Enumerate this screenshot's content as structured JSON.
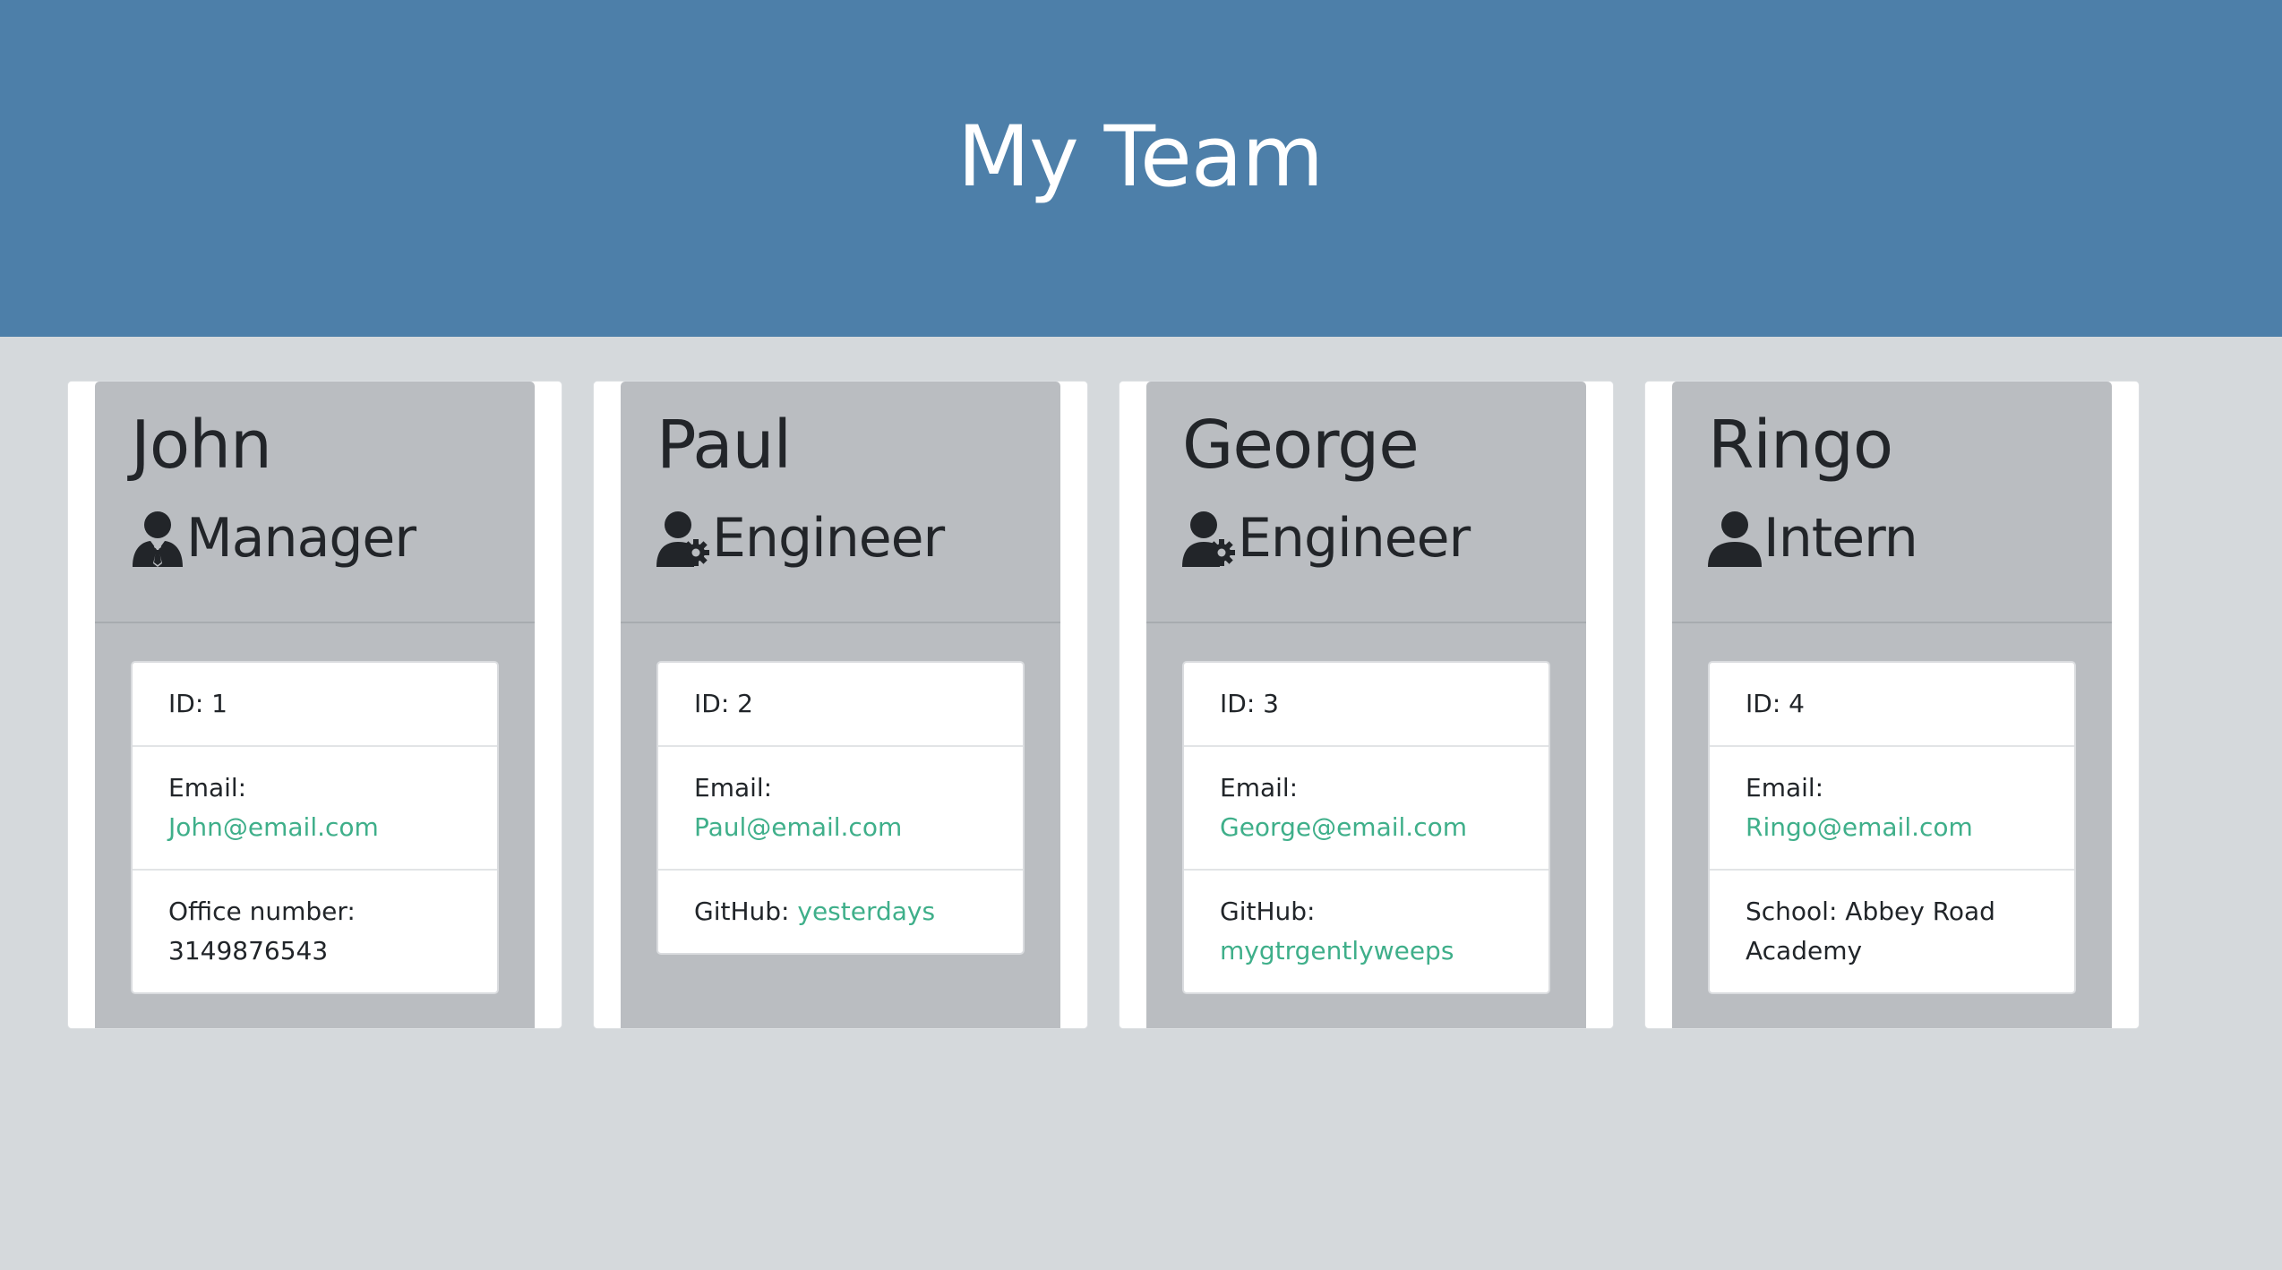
{
  "header": {
    "title": "My Team"
  },
  "colors": {
    "header_bg": "#4d7fa9",
    "link": "#3faf8a",
    "card_bg": "#babdc1"
  },
  "cards": [
    {
      "name": "John",
      "role": "Manager",
      "role_icon": "user-tie-icon",
      "id_label": "ID: 1",
      "email_label": "Email:",
      "email": "John@email.com",
      "extra_label": "Office number:",
      "extra_value": "3149876543"
    },
    {
      "name": "Paul",
      "role": "Engineer",
      "role_icon": "user-cog-icon",
      "id_label": "ID: 2",
      "email_label": "Email:",
      "email": "Paul@email.com",
      "extra_label": "GitHub:",
      "extra_value": "yesterdays"
    },
    {
      "name": "George",
      "role": "Engineer",
      "role_icon": "user-cog-icon",
      "id_label": "ID: 3",
      "email_label": "Email:",
      "email": "George@email.com",
      "extra_label": "GitHub:",
      "extra_value": "mygtrgentlyweeps"
    },
    {
      "name": "Ringo",
      "role": "Intern",
      "role_icon": "user-icon",
      "id_label": "ID: 4",
      "email_label": "Email:",
      "email": "Ringo@email.com",
      "extra_label": "School:",
      "extra_value": "Abbey Road Academy"
    }
  ]
}
